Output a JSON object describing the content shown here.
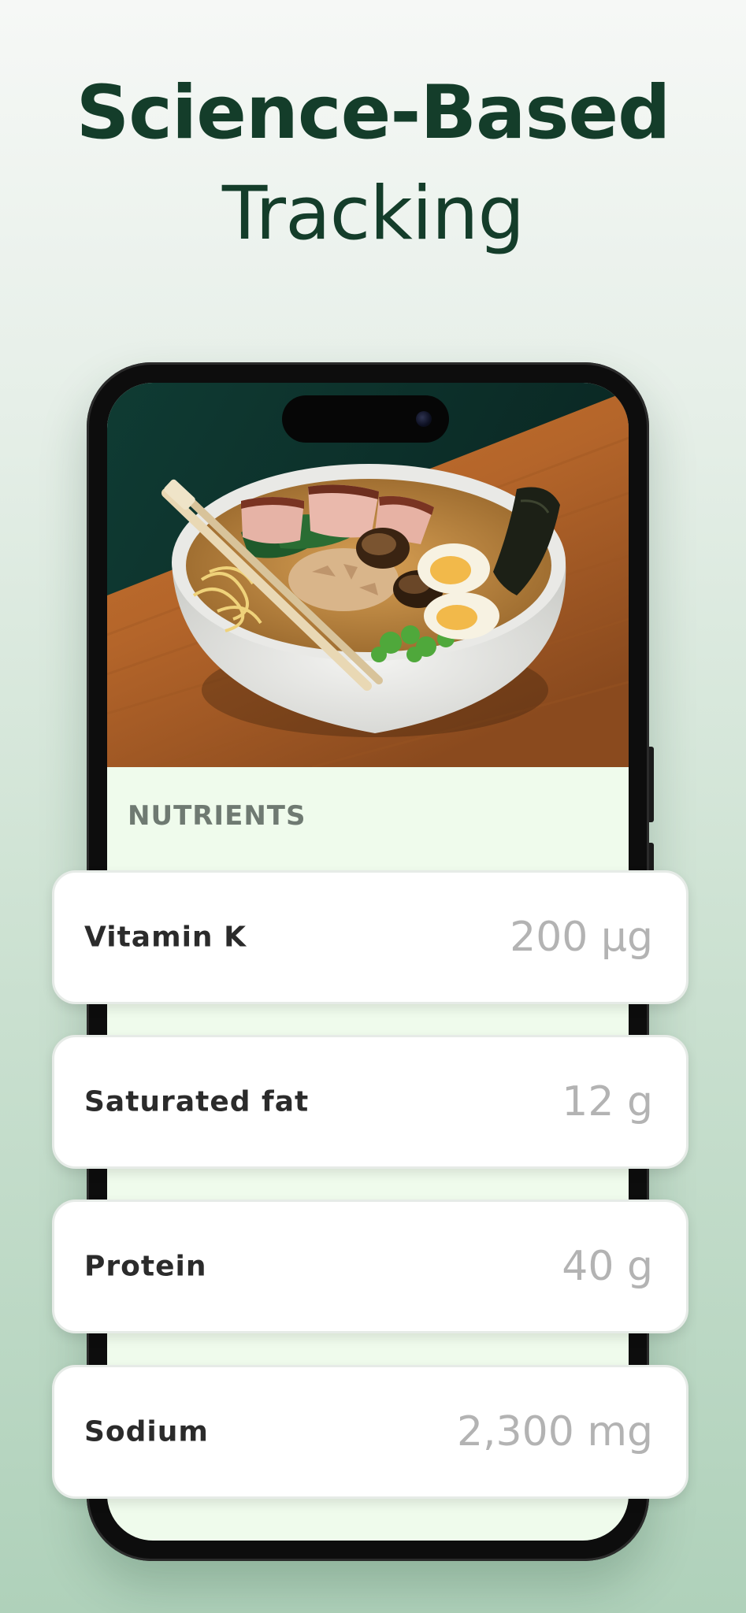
{
  "headline": {
    "line1": "Science-Based",
    "line2": "Tracking"
  },
  "screen": {
    "section_label": "NUTRIENTS",
    "photo_subject": "Ramen bowl with chashu pork, soft-boiled egg halves, mushrooms, nori, greens and chopsticks on a wooden table"
  },
  "nutrients": [
    {
      "name": "Vitamin K",
      "value": "200 µg"
    },
    {
      "name": "Saturated fat",
      "value": "12 g"
    },
    {
      "name": "Protein",
      "value": "40 g"
    },
    {
      "name": "Sodium",
      "value": "2,300 mg"
    }
  ],
  "colors": {
    "headline": "#143d2a",
    "screen_background": "#effbec",
    "nutrient_value": "#b3b3b3",
    "nutrient_name": "#2b2b2b"
  }
}
